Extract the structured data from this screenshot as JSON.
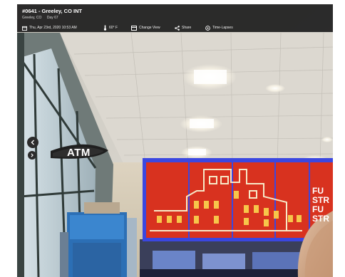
{
  "camera": {
    "title": "#0641 - Greeley, CO INT",
    "location": "Greeley, CO",
    "day": "Day 67"
  },
  "toolbar": {
    "datetime": "Thu, Apr 23rd, 2020 10:53 AM",
    "temperature": "60° F",
    "change_view": "Change View",
    "share": "Share",
    "time_lapses": "Time-Lapses"
  },
  "scene": {
    "atm_label": "ATM",
    "sign_lines": [
      "FU",
      "STR",
      "FU",
      "STR"
    ]
  },
  "colors": {
    "header_bg": "#1e1e1e",
    "sign_red": "#d8321f",
    "sign_border": "#3b47e0"
  },
  "icons": {
    "datetime": "calendar-icon",
    "temperature": "thermometer-icon",
    "change_view": "view-icon",
    "share": "share-icon",
    "time_lapses": "clock-icon",
    "nav_prev": "chevron-left-icon",
    "nav_next": "chevron-right-icon"
  }
}
